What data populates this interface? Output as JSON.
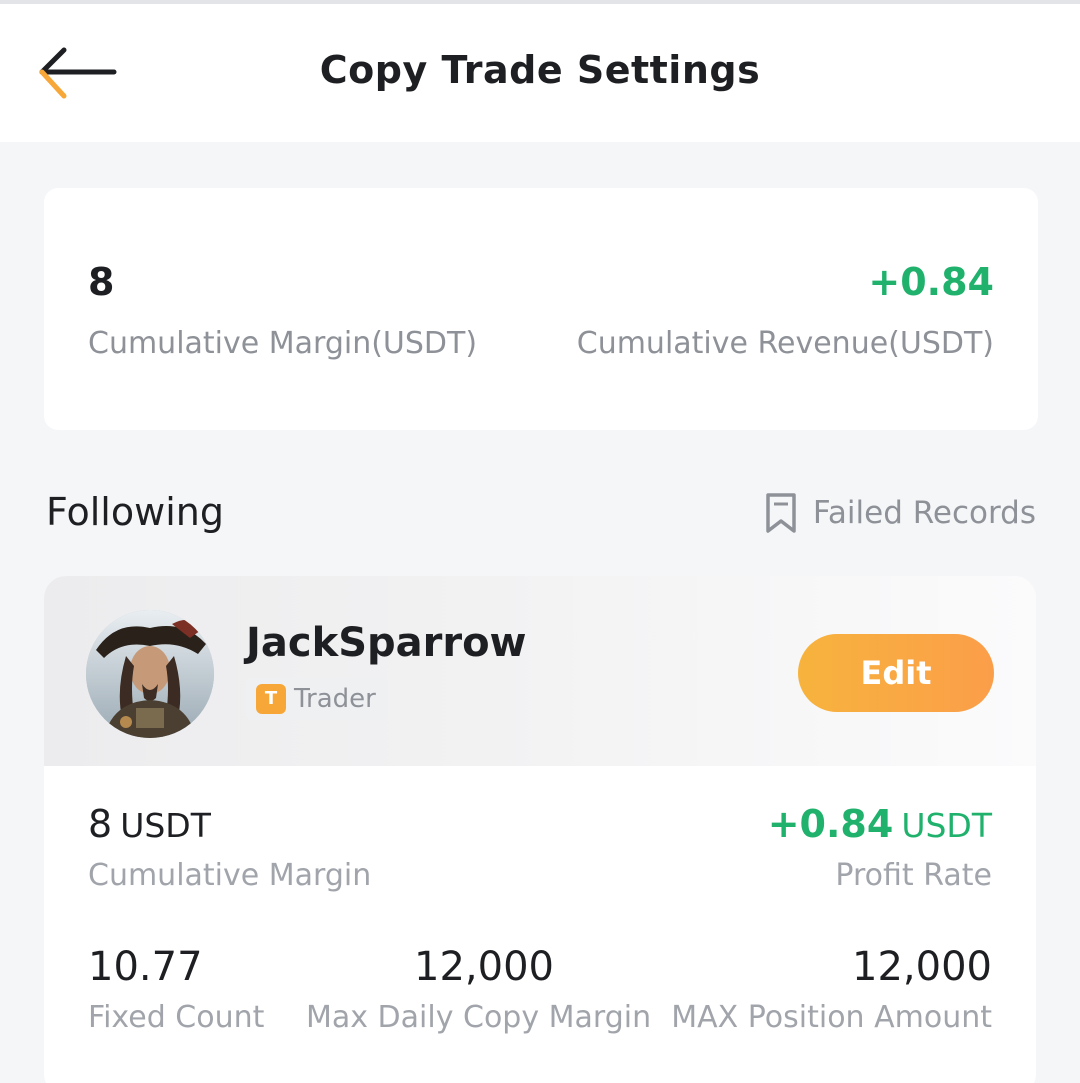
{
  "header": {
    "title": "Copy Trade Settings",
    "back_icon": "arrow-left-icon"
  },
  "summary": {
    "cumulative_margin_value": "8",
    "cumulative_margin_label": "Cumulative Margin(USDT)",
    "cumulative_revenue_value": "+0.84",
    "cumulative_revenue_label": "Cumulative Revenue(USDT)",
    "revenue_color": "#20b26c"
  },
  "following": {
    "title": "Following",
    "failed_records_label": "Failed Records",
    "failed_records_icon": "bookmark-icon"
  },
  "trader": {
    "name": "JackSparrow",
    "badge_icon_letter": "T",
    "badge_label": "Trader",
    "edit_label": "Edit",
    "margin_value": "8",
    "margin_unit": "USDT",
    "margin_label": "Cumulative Margin",
    "profit_value": "+0.84",
    "profit_unit": "USDT",
    "profit_label": "Profit Rate",
    "stats": [
      {
        "value": "10.77",
        "label": "Fixed Count"
      },
      {
        "value": "12,000",
        "label": "Max Daily Copy Margin"
      },
      {
        "value": "12,000",
        "label": "MAX Position Amount"
      }
    ]
  },
  "colors": {
    "accent": "#f7a737",
    "positive": "#20b26c",
    "muted_text": "#8e9298"
  }
}
